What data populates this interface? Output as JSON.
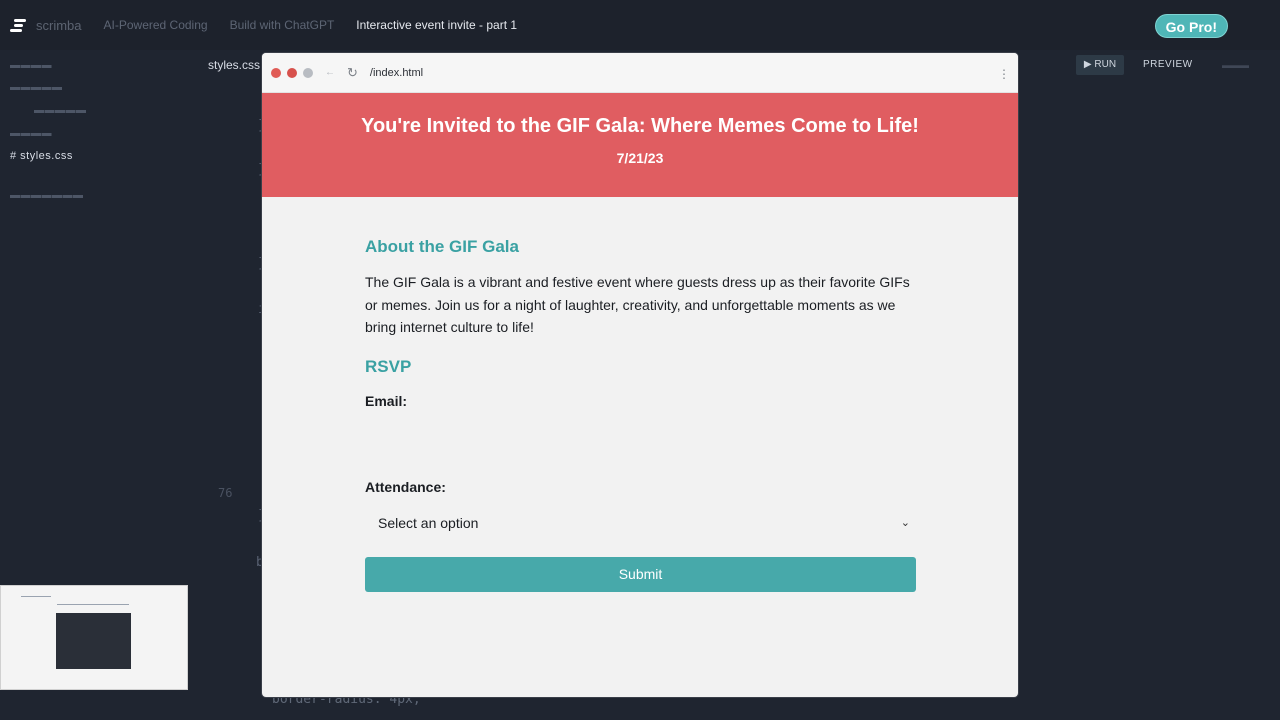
{
  "app": {
    "logo_text": "scrimba",
    "breadcrumbs": [
      "AI-Powered Coding",
      "Build with ChatGPT",
      "Interactive event invite - part 1"
    ],
    "go_pro_label": "Go Pro!"
  },
  "sidebar": {
    "current_file": "# styles.css"
  },
  "editor": {
    "tab_label": "styles.css",
    "line_number": "76",
    "bottom_code": "border-radius: 4px;"
  },
  "toolbar": {
    "run_label": "▶ RUN",
    "preview_label": "PREVIEW"
  },
  "browser": {
    "url": "/index.html"
  },
  "page": {
    "title": "You're Invited to the GIF Gala: Where Memes Come to Life!",
    "date": "7/21/23",
    "about_heading": "About the GIF Gala",
    "about_text": "The GIF Gala is a vibrant and festive event where guests dress up as their favorite GIFs or memes. Join us for a night of laughter, creativity, and unforgettable moments as we bring internet culture to life!",
    "rsvp_heading": "RSVP",
    "email_label": "Email:",
    "attendance_label": "Attendance:",
    "attendance_value": "Select an option",
    "submit_label": "Submit"
  },
  "colors": {
    "hero_bg": "#e05d61",
    "accent_teal": "#3aa1a3",
    "submit_bg": "#47a9aa",
    "go_pro_bg": "#4fb6b7"
  }
}
